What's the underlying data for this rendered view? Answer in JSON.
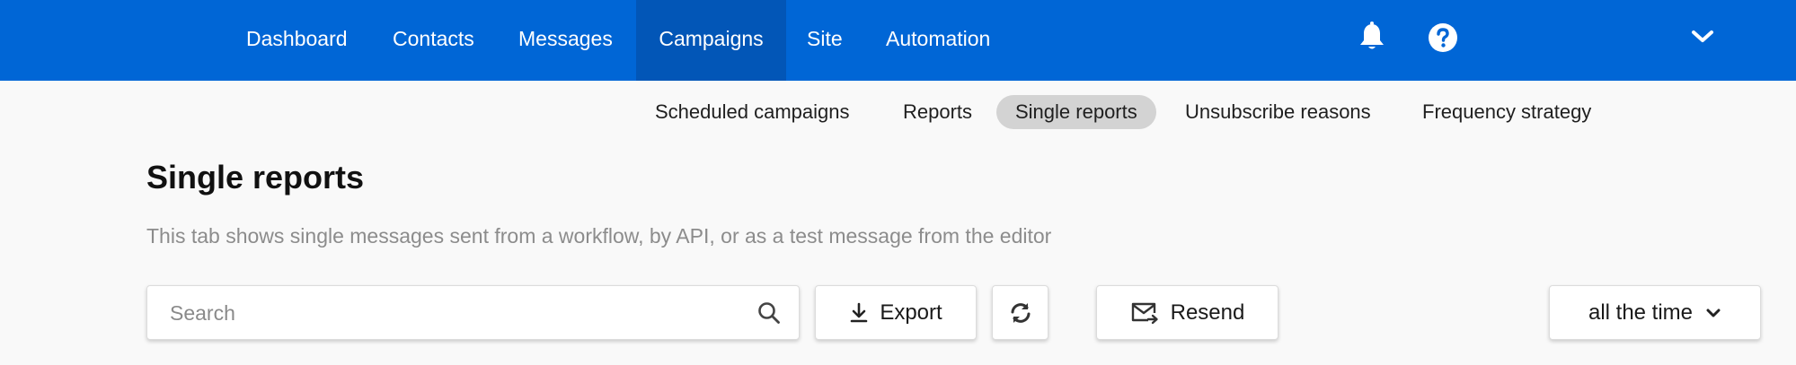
{
  "nav": {
    "items": [
      {
        "label": "Dashboard"
      },
      {
        "label": "Contacts"
      },
      {
        "label": "Messages"
      },
      {
        "label": "Campaigns",
        "active": true
      },
      {
        "label": "Site"
      },
      {
        "label": "Automation"
      }
    ],
    "icons": [
      "bell-icon",
      "help-icon",
      "chevron-down-icon"
    ],
    "background": "#0066d6",
    "active_background": "#0256b7"
  },
  "subnav": {
    "items": [
      {
        "label": "Scheduled campaigns"
      },
      {
        "label": "Reports"
      },
      {
        "label": "Single reports",
        "active": true
      },
      {
        "label": "Unsubscribe reasons"
      },
      {
        "label": "Frequency strategy"
      }
    ]
  },
  "page": {
    "title": "Single reports",
    "description": "This tab shows single messages sent from a workflow, by API, or as a test message from the editor"
  },
  "toolbar": {
    "search_placeholder": "Search",
    "export_label": "Export",
    "resend_label": "Resend",
    "time_filter_label": "all the time"
  }
}
